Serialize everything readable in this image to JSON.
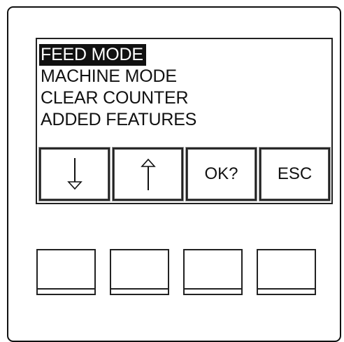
{
  "display": {
    "menu": [
      {
        "label": "FEED MODE",
        "selected": true
      },
      {
        "label": "MACHINE MODE",
        "selected": false
      },
      {
        "label": "CLEAR COUNTER",
        "selected": false
      },
      {
        "label": "ADDED FEATURES",
        "selected": false
      }
    ],
    "softkeys": [
      {
        "icon": "arrow-down-icon"
      },
      {
        "icon": "arrow-up-icon"
      },
      {
        "label": "OK?"
      },
      {
        "label": "ESC"
      }
    ]
  },
  "hardware_buttons": 4
}
